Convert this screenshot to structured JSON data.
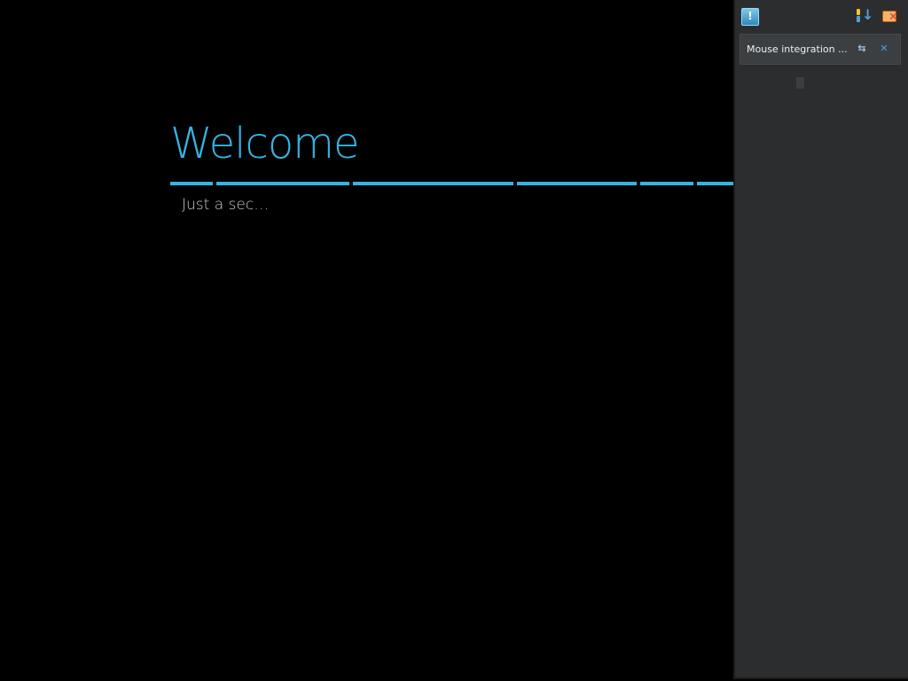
{
  "setup": {
    "title": "Welcome",
    "status": "Just a sec…"
  },
  "notification_panel": {
    "toolbar": {
      "notify_icon": "notification-icon",
      "sort_icon": "sort-order-icon",
      "clear_icon": "clear-all-icon"
    },
    "items": [
      {
        "text": "Mouse integration ...",
        "pin_icon": "pin-icon",
        "close_icon": "close-icon"
      }
    ]
  },
  "colors": {
    "accent": "#33b5e5",
    "background": "#000000",
    "panel": "#2b2d2e"
  }
}
